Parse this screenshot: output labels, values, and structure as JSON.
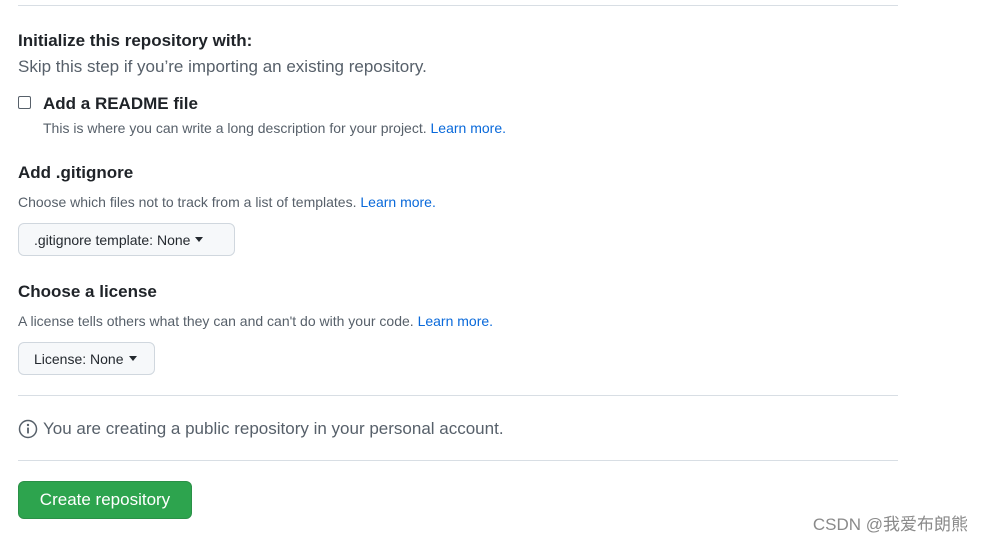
{
  "initialize": {
    "title": "Initialize this repository with:",
    "subtitle": "Skip this step if you’re importing an existing repository."
  },
  "readme": {
    "checked": false,
    "label": "Add a README file",
    "description": "This is where you can write a long description for your project.",
    "learn_more": "Learn more."
  },
  "gitignore": {
    "title": "Add .gitignore",
    "description": "Choose which files not to track from a list of templates.",
    "learn_more": "Learn more.",
    "button_label": ".gitignore template: None"
  },
  "license": {
    "title": "Choose a license",
    "description": "A license tells others what they can and can't do with your code.",
    "learn_more": "Learn more.",
    "button_label": "License: None"
  },
  "notice": {
    "icon": "info-icon",
    "text": "You are creating a public repository in your personal account."
  },
  "create_button": {
    "label": "Create repository",
    "color": "#2da44e"
  },
  "watermark": "CSDN @我爱布朗熊",
  "colors": {
    "link": "#0969da",
    "muted_text": "#57606a",
    "border": "#d0d7de"
  }
}
